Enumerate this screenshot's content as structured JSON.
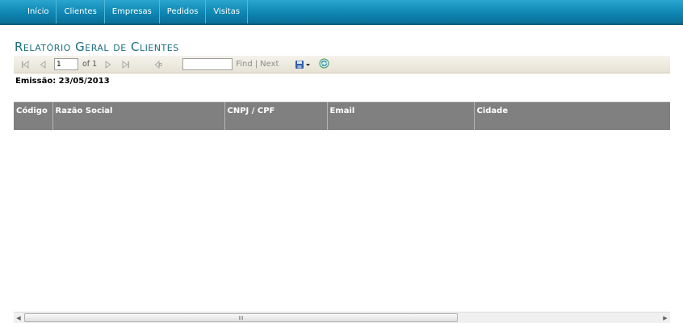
{
  "nav": {
    "items": [
      {
        "label": "Início"
      },
      {
        "label": "Clientes"
      },
      {
        "label": "Empresas"
      },
      {
        "label": "Pedidos"
      },
      {
        "label": "Visitas"
      }
    ]
  },
  "report": {
    "title": "Relatório Geral de Clientes",
    "emission": "Emissão: 23/05/2013"
  },
  "toolbar": {
    "page_value": "1",
    "of_label": "of 1",
    "find_label": "Find",
    "separator": "|",
    "next_label": "Next",
    "icons": {
      "first": "first-page-icon",
      "prev": "previous-page-icon",
      "next": "next-page-icon",
      "last": "last-page-icon",
      "back": "back-to-parent-icon",
      "export": "export-save-icon",
      "refresh": "refresh-icon"
    }
  },
  "table": {
    "columns": [
      "Código",
      "Razão Social",
      "CNPJ / CPF",
      "Email",
      "Cidade"
    ]
  },
  "scrollbar": {
    "grip": "III"
  }
}
